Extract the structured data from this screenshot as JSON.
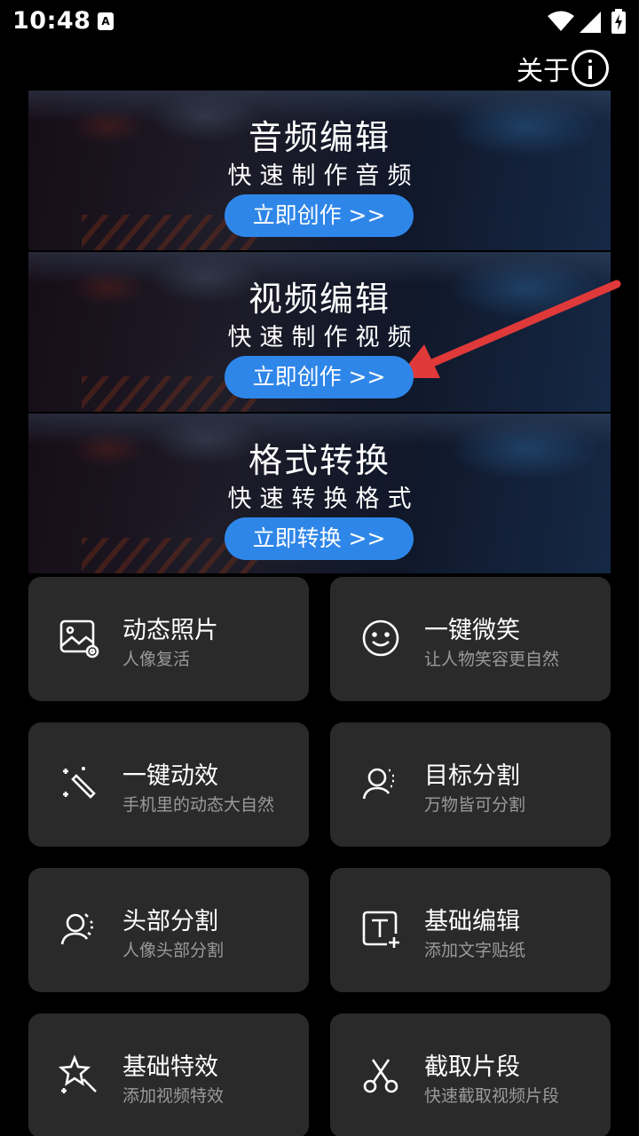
{
  "status_bar": {
    "time": "10:48",
    "notification_badge": "A"
  },
  "header": {
    "about_label": "关于"
  },
  "banners": [
    {
      "title": "音频编辑",
      "subtitle": "快速制作音频",
      "button": "立即创作 >>"
    },
    {
      "title": "视频编辑",
      "subtitle": "快速制作视频",
      "button": "立即创作 >>"
    },
    {
      "title": "格式转换",
      "subtitle": "快速转换格式",
      "button": "立即转换 >>"
    }
  ],
  "features": [
    {
      "title": "动态照片",
      "subtitle": "人像复活",
      "icon": "photo-gear-icon"
    },
    {
      "title": "一键微笑",
      "subtitle": "让人物笑容更自然",
      "icon": "smile-icon"
    },
    {
      "title": "一键动效",
      "subtitle": "手机里的动态大自然",
      "icon": "magic-wand-icon"
    },
    {
      "title": "目标分割",
      "subtitle": "万物皆可分割",
      "icon": "person-segment-icon"
    },
    {
      "title": "头部分割",
      "subtitle": "人像头部分割",
      "icon": "head-segment-icon"
    },
    {
      "title": "基础编辑",
      "subtitle": "添加文字贴纸",
      "icon": "text-add-icon"
    },
    {
      "title": "基础特效",
      "subtitle": "添加视频特效",
      "icon": "star-wand-icon"
    },
    {
      "title": "截取片段",
      "subtitle": "快速截取视频片段",
      "icon": "scissors-icon"
    }
  ],
  "colors": {
    "accent": "#2f86e9",
    "card_bg": "#2a2a2a",
    "annotation_arrow": "#e0393a"
  }
}
